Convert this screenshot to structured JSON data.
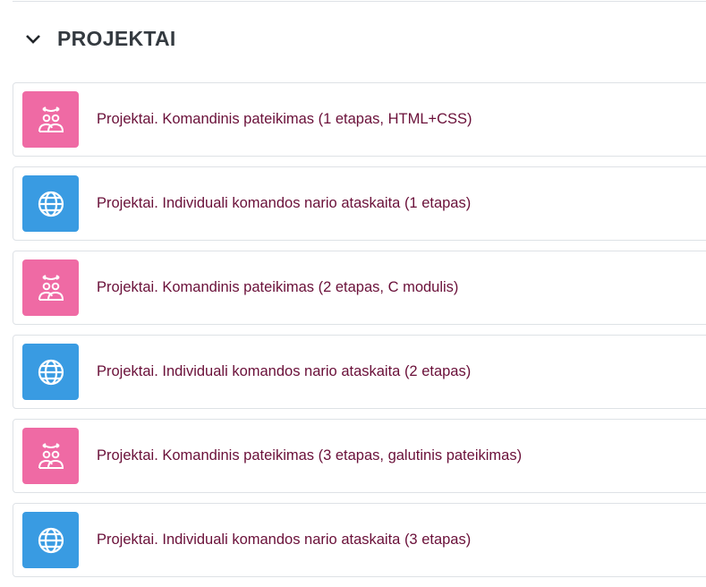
{
  "section": {
    "title": "PROJEKTAI",
    "expanded": true
  },
  "colors": {
    "pink": "#ef6aa4",
    "blue": "#399be2",
    "text": "#6a1039"
  },
  "activities": [
    {
      "label": "Projektai. Komandinis pateikimas (1 etapas, HTML+CSS)",
      "icon": "workshop-icon",
      "type": "pink"
    },
    {
      "label": "Projektai. Individuali komandos nario ataskaita (1 etapas)",
      "icon": "globe-icon",
      "type": "blue"
    },
    {
      "label": "Projektai. Komandinis pateikimas (2 etapas, C modulis)",
      "icon": "workshop-icon",
      "type": "pink"
    },
    {
      "label": "Projektai. Individuali komandos nario ataskaita (2 etapas)",
      "icon": "globe-icon",
      "type": "blue"
    },
    {
      "label": "Projektai. Komandinis pateikimas (3 etapas, galutinis pateikimas)",
      "icon": "workshop-icon",
      "type": "pink"
    },
    {
      "label": "Projektai. Individuali komandos nario ataskaita (3 etapas)",
      "icon": "globe-icon",
      "type": "blue"
    }
  ]
}
